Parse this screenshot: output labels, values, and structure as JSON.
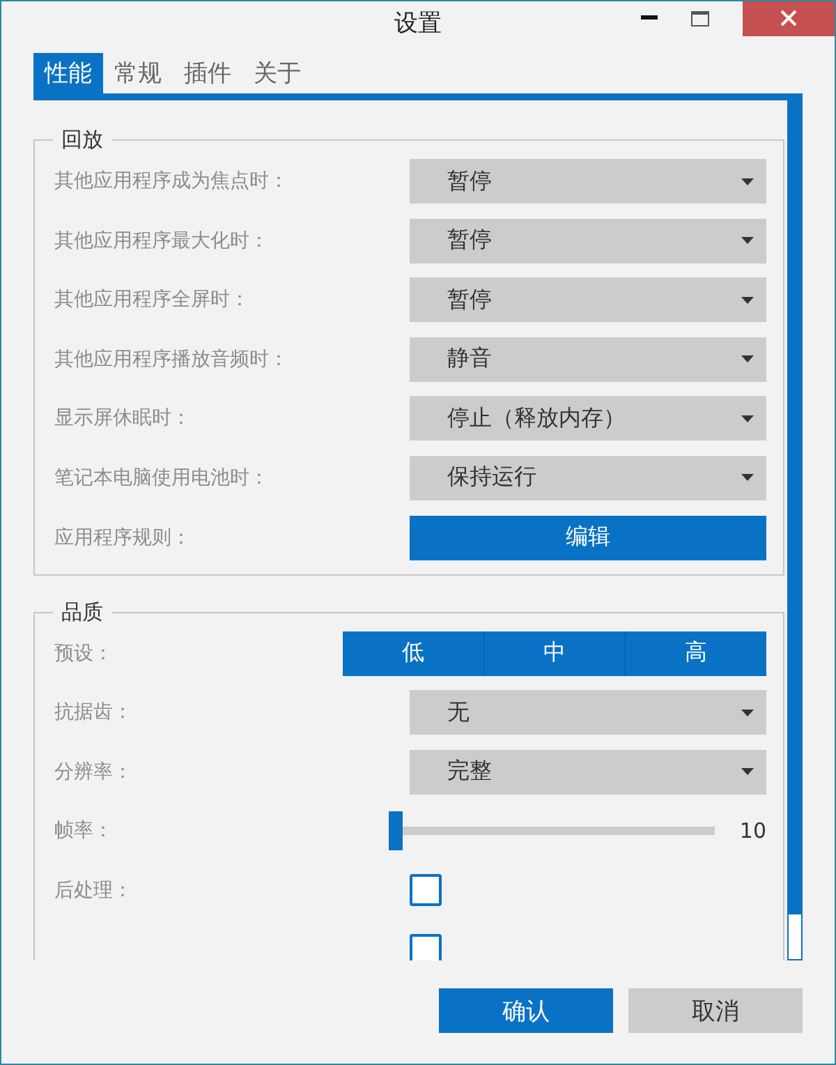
{
  "window": {
    "title": "设置"
  },
  "tabs": [
    {
      "label": "性能",
      "selected": true
    },
    {
      "label": "常规",
      "selected": false
    },
    {
      "label": "插件",
      "selected": false
    },
    {
      "label": "关于",
      "selected": false
    }
  ],
  "sections": [
    {
      "title": "回放",
      "rows": [
        {
          "kind": "dropdown",
          "label": "其他应用程序成为焦点时：",
          "value": "暂停"
        },
        {
          "kind": "dropdown",
          "label": "其他应用程序最大化时：",
          "value": "暂停"
        },
        {
          "kind": "dropdown",
          "label": "其他应用程序全屏时：",
          "value": "暂停"
        },
        {
          "kind": "dropdown",
          "label": "其他应用程序播放音频时：",
          "value": "静音"
        },
        {
          "kind": "dropdown",
          "label": "显示屏休眠时：",
          "value": "停止（释放内存）"
        },
        {
          "kind": "dropdown",
          "label": "笔记本电脑使用电池时：",
          "value": "保持运行"
        },
        {
          "kind": "button",
          "label": "应用程序规则：",
          "button": "编辑"
        }
      ]
    },
    {
      "title": "品质",
      "rows": [
        {
          "kind": "segmented",
          "label": "预设：",
          "options": [
            "低",
            "中",
            "高"
          ]
        },
        {
          "kind": "dropdown",
          "label": "抗据齿：",
          "value": "无"
        },
        {
          "kind": "dropdown",
          "label": "分辨率：",
          "value": "完整"
        },
        {
          "kind": "slider",
          "label": "帧率：",
          "level": 0,
          "reading": "10"
        },
        {
          "kind": "checkbox",
          "label": "后处理：",
          "checked": false
        },
        {
          "kind": "checkbox",
          "checked": false
        }
      ]
    }
  ],
  "buttons": [
    {
      "label": "确认",
      "primary": true
    },
    {
      "label": "取消",
      "primary": false
    }
  ]
}
